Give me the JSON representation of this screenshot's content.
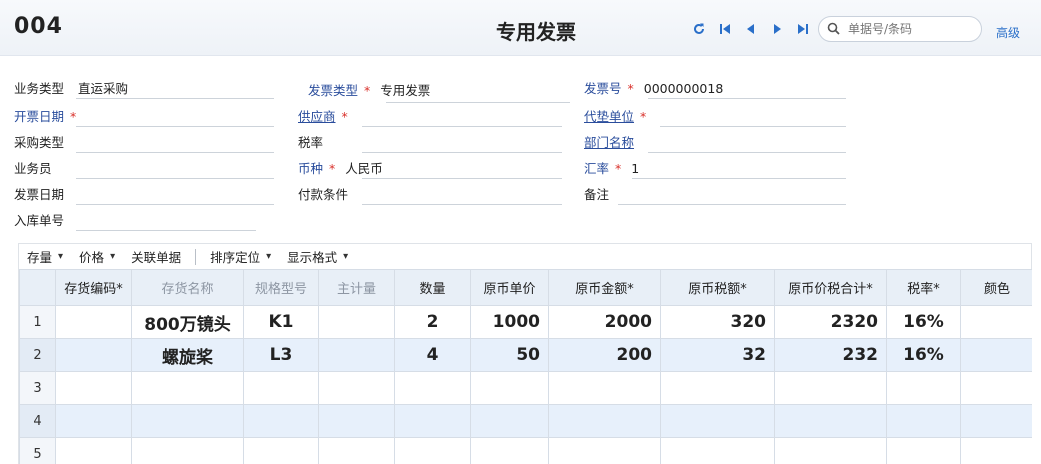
{
  "header": {
    "doc_no": "004",
    "title": "专用发票",
    "search_placeholder": "单据号/条码",
    "advanced_label": "高级"
  },
  "form": {
    "business_type_label": "业务类型",
    "business_type_value": "直运采购",
    "invoice_type_label": "发票类型",
    "invoice_type_value": "专用发票",
    "invoice_no_label": "发票号",
    "invoice_no_value": "0000000018",
    "issue_date_label": "开票日期",
    "supplier_label": "供应商",
    "agent_unit_label": "代垫单位",
    "purchase_type_label": "采购类型",
    "tax_rate_label": "税率",
    "department_label": "部门名称",
    "salesman_label": "业务员",
    "currency_label": "币种",
    "currency_value": "人民币",
    "exchange_rate_label": "汇率",
    "exchange_rate_value": "1",
    "invoice_date_label": "发票日期",
    "payment_terms_label": "付款条件",
    "remark_label": "备注",
    "stock_in_no_label": "入库单号",
    "required_mark": "*"
  },
  "toolbar": {
    "inventory": "存量",
    "price": "价格",
    "related": "关联单据",
    "sort": "排序定位",
    "display": "显示格式",
    "caret": "▾"
  },
  "grid": {
    "columns": [
      "存货编码*",
      "存货名称",
      "规格型号",
      "主计量",
      "数量",
      "原币单价",
      "原币金额*",
      "原币税额*",
      "原币价税合计*",
      "税率*",
      "颜色"
    ],
    "rows": [
      {
        "num": "1",
        "code": "",
        "name": "800万镜头",
        "spec": "K1",
        "unit": "",
        "qty": "2",
        "price": "1000",
        "amount": "2000",
        "tax": "320",
        "total": "2320",
        "rate": "16%",
        "color": ""
      },
      {
        "num": "2",
        "code": "",
        "name": "螺旋桨",
        "spec": "L3",
        "unit": "",
        "qty": "4",
        "price": "50",
        "amount": "200",
        "tax": "32",
        "total": "232",
        "rate": "16%",
        "color": ""
      },
      {
        "num": "3",
        "code": "",
        "name": "",
        "spec": "",
        "unit": "",
        "qty": "",
        "price": "",
        "amount": "",
        "tax": "",
        "total": "",
        "rate": "",
        "color": ""
      },
      {
        "num": "4",
        "code": "",
        "name": "",
        "spec": "",
        "unit": "",
        "qty": "",
        "price": "",
        "amount": "",
        "tax": "",
        "total": "",
        "rate": "",
        "color": ""
      },
      {
        "num": "5",
        "code": "",
        "name": "",
        "spec": "",
        "unit": "",
        "qty": "",
        "price": "",
        "amount": "",
        "tax": "",
        "total": "",
        "rate": "",
        "color": ""
      }
    ]
  },
  "colors": {
    "accent": "#2a6fc9",
    "required": "#d9302a",
    "header_bg": "#e8eff7",
    "alt_row_bg": "#e7f0fb"
  }
}
